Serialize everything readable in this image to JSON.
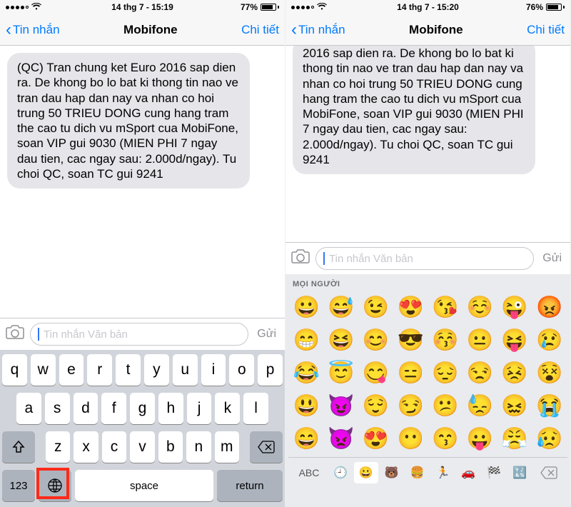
{
  "left": {
    "status": {
      "time": "14 thg 7 - 15:19",
      "battery_pct": "77%",
      "battery_fill": 77
    },
    "nav": {
      "back": "Tin nhắn",
      "title": "Mobifone",
      "right": "Chi tiết"
    },
    "message": "(QC) Tran chung ket Euro 2016 sap dien ra. De khong bo lo bat ki thong tin nao ve tran dau hap dan nay va nhan co hoi trung 50 TRIEU DONG cung hang tram the cao tu dich vu mSport cua MobiFone, soan VIP gui 9030 (MIEN PHI 7 ngay dau tien, cac ngay sau: 2.000d/ngay). Tu choi QC, soan TC gui 9241",
    "compose": {
      "placeholder": "Tin nhắn Văn bản",
      "send": "Gửi"
    },
    "keyboard": {
      "row1": [
        "q",
        "w",
        "e",
        "r",
        "t",
        "y",
        "u",
        "i",
        "o",
        "p"
      ],
      "row2": [
        "a",
        "s",
        "d",
        "f",
        "g",
        "h",
        "j",
        "k",
        "l"
      ],
      "row3": [
        "z",
        "x",
        "c",
        "v",
        "b",
        "n",
        "m"
      ],
      "num": "123",
      "space": "space",
      "return": "return"
    }
  },
  "right": {
    "status": {
      "time": "14 thg 7 - 15:20",
      "battery_pct": "76%",
      "battery_fill": 76
    },
    "nav": {
      "back": "Tin nhắn",
      "title": "Mobifone",
      "right": "Chi tiết"
    },
    "message": "2016 sap dien ra. De khong bo lo bat ki thong tin nao ve tran dau hap dan nay va nhan co hoi trung 50 TRIEU DONG cung hang tram the cao tu dich vu mSport cua MobiFone, soan VIP gui 9030 (MIEN PHI 7 ngay dau tien, cac ngay sau: 2.000d/ngay). Tu choi QC, soan TC gui 9241",
    "compose": {
      "placeholder": "Tin nhắn Văn bản",
      "send": "Gửi"
    },
    "emoji": {
      "header": "MỌI NGƯỜI",
      "grid": [
        "😀",
        "😅",
        "😉",
        "😍",
        "😘",
        "☺️",
        "😜",
        "😡",
        "😁",
        "😆",
        "😊",
        "😎",
        "😚",
        "😐",
        "😝",
        "😢",
        "😂",
        "😇",
        "😋",
        "😑",
        "😔",
        "😒",
        "😣",
        "😵",
        "😃",
        "😈",
        "😌",
        "😏",
        "😕",
        "😓",
        "😖",
        "😭",
        "😄",
        "👿",
        "😍",
        "😶",
        "😙",
        "😛",
        "😤",
        "😥"
      ],
      "abc": "ABC",
      "categories": [
        "🕘",
        "😀",
        "🐻",
        "🍔",
        "🏃",
        "🚗",
        "🏁",
        "🔣"
      ]
    }
  }
}
